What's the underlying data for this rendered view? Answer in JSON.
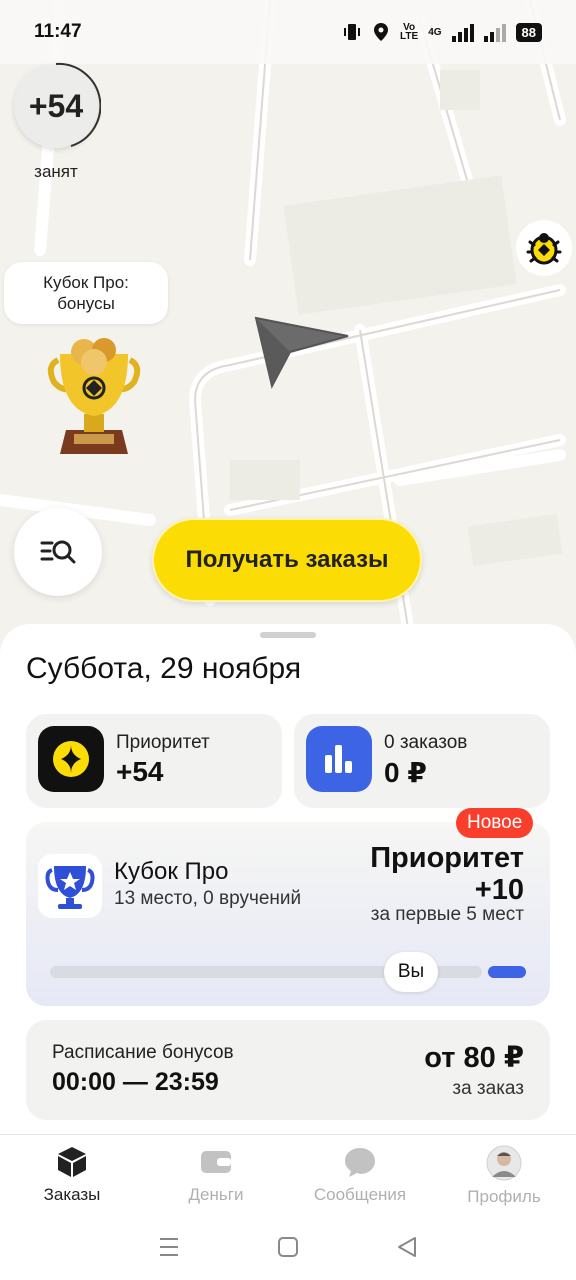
{
  "status_bar": {
    "time": "11:47",
    "volte": "Vo\nLTE",
    "network": "4G",
    "battery": "88"
  },
  "map": {
    "priority_value": "+54",
    "priority_label": "занят",
    "cup_bubble_line1": "Кубок Про:",
    "cup_bubble_line2": "бонусы"
  },
  "main_button": {
    "label": "Получать заказы"
  },
  "sheet": {
    "date": "Суббота, 29 ноября",
    "priority_tile": {
      "title": "Приоритет",
      "value": "+54"
    },
    "orders_tile": {
      "title": "0 заказов",
      "value": "0 ₽"
    },
    "cup": {
      "badge": "Новое",
      "title": "Кубок Про",
      "subtitle": "13 место, 0 вручений",
      "priority_line1": "Приоритет",
      "priority_line2": "+10",
      "note": "за первые 5 мест",
      "you_label": "Вы"
    },
    "schedule": {
      "title": "Расписание бонусов",
      "time": "00:00 — 23:59",
      "amount": "от 80 ₽",
      "per": "за заказ"
    }
  },
  "bottom_nav": {
    "items": [
      {
        "label": "Заказы",
        "icon": "box-icon",
        "active": true
      },
      {
        "label": "Деньги",
        "icon": "wallet-icon",
        "active": false
      },
      {
        "label": "Сообщения",
        "icon": "chat-icon",
        "active": false
      },
      {
        "label": "Профиль",
        "icon": "avatar-icon",
        "active": false
      }
    ]
  },
  "colors": {
    "accent_yellow": "#fcdc05",
    "badge_red": "#fa3e2c",
    "blue": "#3e64e6"
  }
}
